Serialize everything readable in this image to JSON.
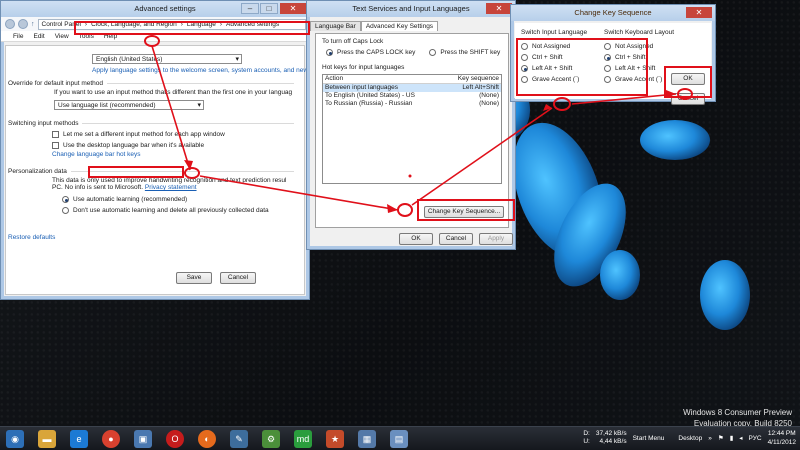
{
  "desktop": {
    "watermark_line1": "Windows 8 Consumer Preview",
    "watermark_line2": "Evaluation copy. Build 8250"
  },
  "advanced": {
    "title": "Advanced settings",
    "breadcrumb": [
      "Control Panel",
      "Clock, Language, and Region",
      "Language",
      "Advanced settings"
    ],
    "menu": [
      "File",
      "Edit",
      "View",
      "Tools",
      "Help"
    ],
    "display_language_value": "English (United States)",
    "apply_link": "Apply language settings to the welcome screen, system accounts, and new user ac",
    "override_header": "Override for default input method",
    "override_desc": "If you want to use an input method that's different than the first one in your languag",
    "override_value": "Use language list (recommended)",
    "switching_header": "Switching input methods",
    "check_per_app": "Let me set a different input method for each app window",
    "check_desktop_bar": "Use the desktop language bar when it's available",
    "hotkeys_link": "Change language bar hot keys",
    "personalization_header": "Personalization data",
    "personalization_desc1": "This data is only used to improve handwriting recognition and text prediction resul",
    "personalization_desc2_a": "PC. No info is sent to Microsoft.",
    "privacy_link": "Privacy statement",
    "radio_auto": "Use automatic learning (recommended)",
    "radio_manual": "Don't use automatic learning and delete all previously collected data",
    "restore_link": "Restore defaults",
    "save_label": "Save",
    "cancel_label": "Cancel"
  },
  "textservices": {
    "title": "Text Services and Input Languages",
    "tabs": [
      "Language Bar",
      "Advanced Key Settings"
    ],
    "caps_header": "To turn off Caps Lock",
    "caps_opt1": "Press the CAPS LOCK key",
    "caps_opt2": "Press the SHIFT key",
    "hotkeys_header": "Hot keys for input languages",
    "col_action": "Action",
    "col_sequence": "Key sequence",
    "rows": [
      {
        "action": "Between input languages",
        "seq": "Left Alt+Shift"
      },
      {
        "action": "To English (United States) - US",
        "seq": "(None)"
      },
      {
        "action": "To Russian (Russia) - Russian",
        "seq": "(None)"
      }
    ],
    "change_btn": "Change Key Sequence...",
    "ok": "OK",
    "cancel": "Cancel",
    "apply": "Apply"
  },
  "keyseq": {
    "title": "Change Key Sequence",
    "col1_header": "Switch Input Language",
    "col1_options": [
      "Not Assigned",
      "Ctrl + Shift",
      "Left Alt + Shift",
      "Grave Accent (`)"
    ],
    "col2_header": "Switch Keyboard Layout",
    "col2_options": [
      "Not Assigned",
      "Ctrl + Shift",
      "Left Alt + Shift",
      "Grave Accent (`)"
    ],
    "ok": "OK",
    "cancel": "Cancel"
  },
  "taskbar": {
    "net_down": "37,42 kB/s",
    "net_up": "4,44 kB/s",
    "net_d_label": "D:",
    "net_u_label": "U:",
    "start_menu": "Start Menu",
    "desktop_label": "Desktop",
    "lang": "РУС",
    "time": "12:44 PM",
    "date": "4/11/2012"
  }
}
